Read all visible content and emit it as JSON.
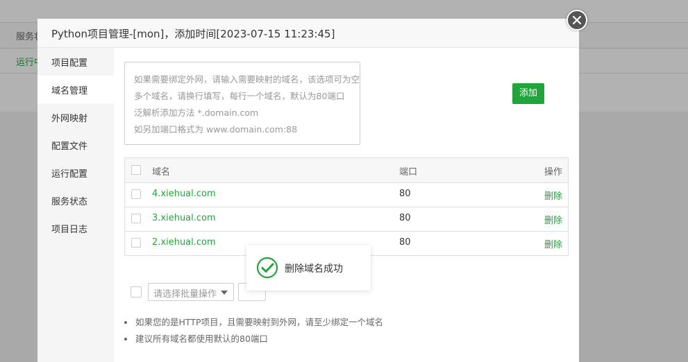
{
  "background": {
    "row1_label": "服务状",
    "row2_label": "运行中"
  },
  "modal": {
    "title": "Python项目管理-[mon]，添加时间[2023-07-15 11:23:45]",
    "sidebar": {
      "items": [
        {
          "label": "项目配置"
        },
        {
          "label": "域名管理",
          "active": true
        },
        {
          "label": "外网映射"
        },
        {
          "label": "配置文件"
        },
        {
          "label": "运行配置"
        },
        {
          "label": "服务状态"
        },
        {
          "label": "项目日志"
        }
      ]
    },
    "domain_input": {
      "placeholder_lines": [
        "如果需要绑定外网，请输入需要映射的域名，该选项可为空",
        "多个域名，请换行填写，每行一个域名，默认为80端口",
        "泛解析添加方法 *.domain.com",
        "如另加端口格式为 www.domain.com:88"
      ]
    },
    "add_button": "添加",
    "table": {
      "headers": {
        "domain": "域名",
        "port": "端口",
        "action": "操作"
      },
      "rows": [
        {
          "domain": "4.xiehual.com",
          "port": "80",
          "action": "删除"
        },
        {
          "domain": "3.xiehual.com",
          "port": "80",
          "action": "删除"
        },
        {
          "domain": "2.xiehual.com",
          "port": "80",
          "action": "删除"
        }
      ]
    },
    "batch": {
      "select_placeholder": "请选择批量操作"
    },
    "notes": [
      "如果您的是HTTP项目，且需要映射到外网，请至少绑定一个域名",
      "建议所有域名都使用默认的80端口"
    ]
  },
  "toast": {
    "message": "删除域名成功"
  },
  "colors": {
    "accent": "#20a53a",
    "overlay": "rgba(0,0,0,0.30)"
  },
  "icons": {
    "close": "close-icon",
    "toast": "check-circle-icon",
    "select_arrow": "chevron-down-icon"
  }
}
